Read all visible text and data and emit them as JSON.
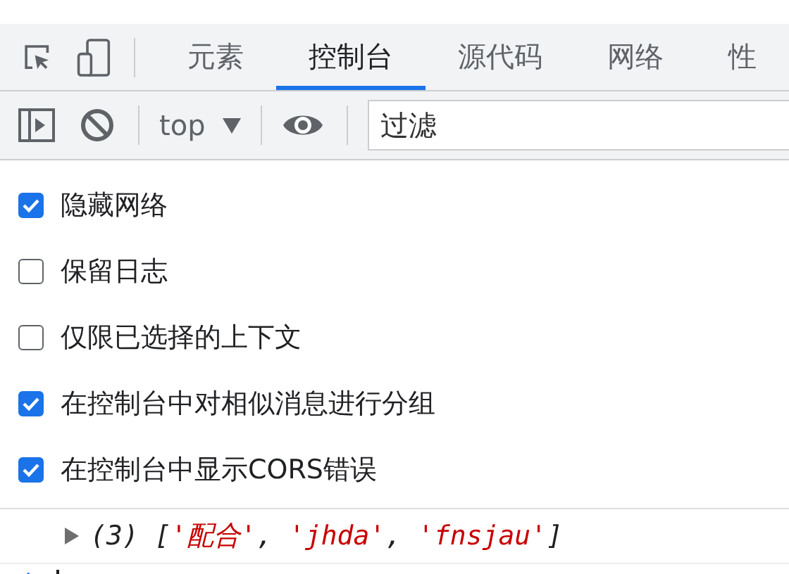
{
  "tabs": [
    {
      "label": "元素",
      "selected": false
    },
    {
      "label": "控制台",
      "selected": true
    },
    {
      "label": "源代码",
      "selected": false
    },
    {
      "label": "网络",
      "selected": false
    },
    {
      "label": "性",
      "selected": false
    }
  ],
  "toolbar": {
    "context": "top",
    "filter": {
      "placeholder": "过滤"
    }
  },
  "settings": [
    {
      "label": "隐藏网络",
      "checked": true
    },
    {
      "label": "保留日志",
      "checked": false
    },
    {
      "label": "仅限已选择的上下文",
      "checked": false
    },
    {
      "label": "在控制台中对相似消息进行分组",
      "checked": true
    },
    {
      "label": "在控制台中显示CORS错误",
      "checked": true
    }
  ],
  "log": {
    "expanded": false,
    "tokens": [
      {
        "text": "(3) [",
        "kind": "plain"
      },
      {
        "text": "'配合'",
        "kind": "string"
      },
      {
        "text": ", ",
        "kind": "plain"
      },
      {
        "text": "'jhda'",
        "kind": "string"
      },
      {
        "text": ", ",
        "kind": "plain"
      },
      {
        "text": "'fnsjau'",
        "kind": "string"
      },
      {
        "text": "]",
        "kind": "plain"
      }
    ]
  }
}
